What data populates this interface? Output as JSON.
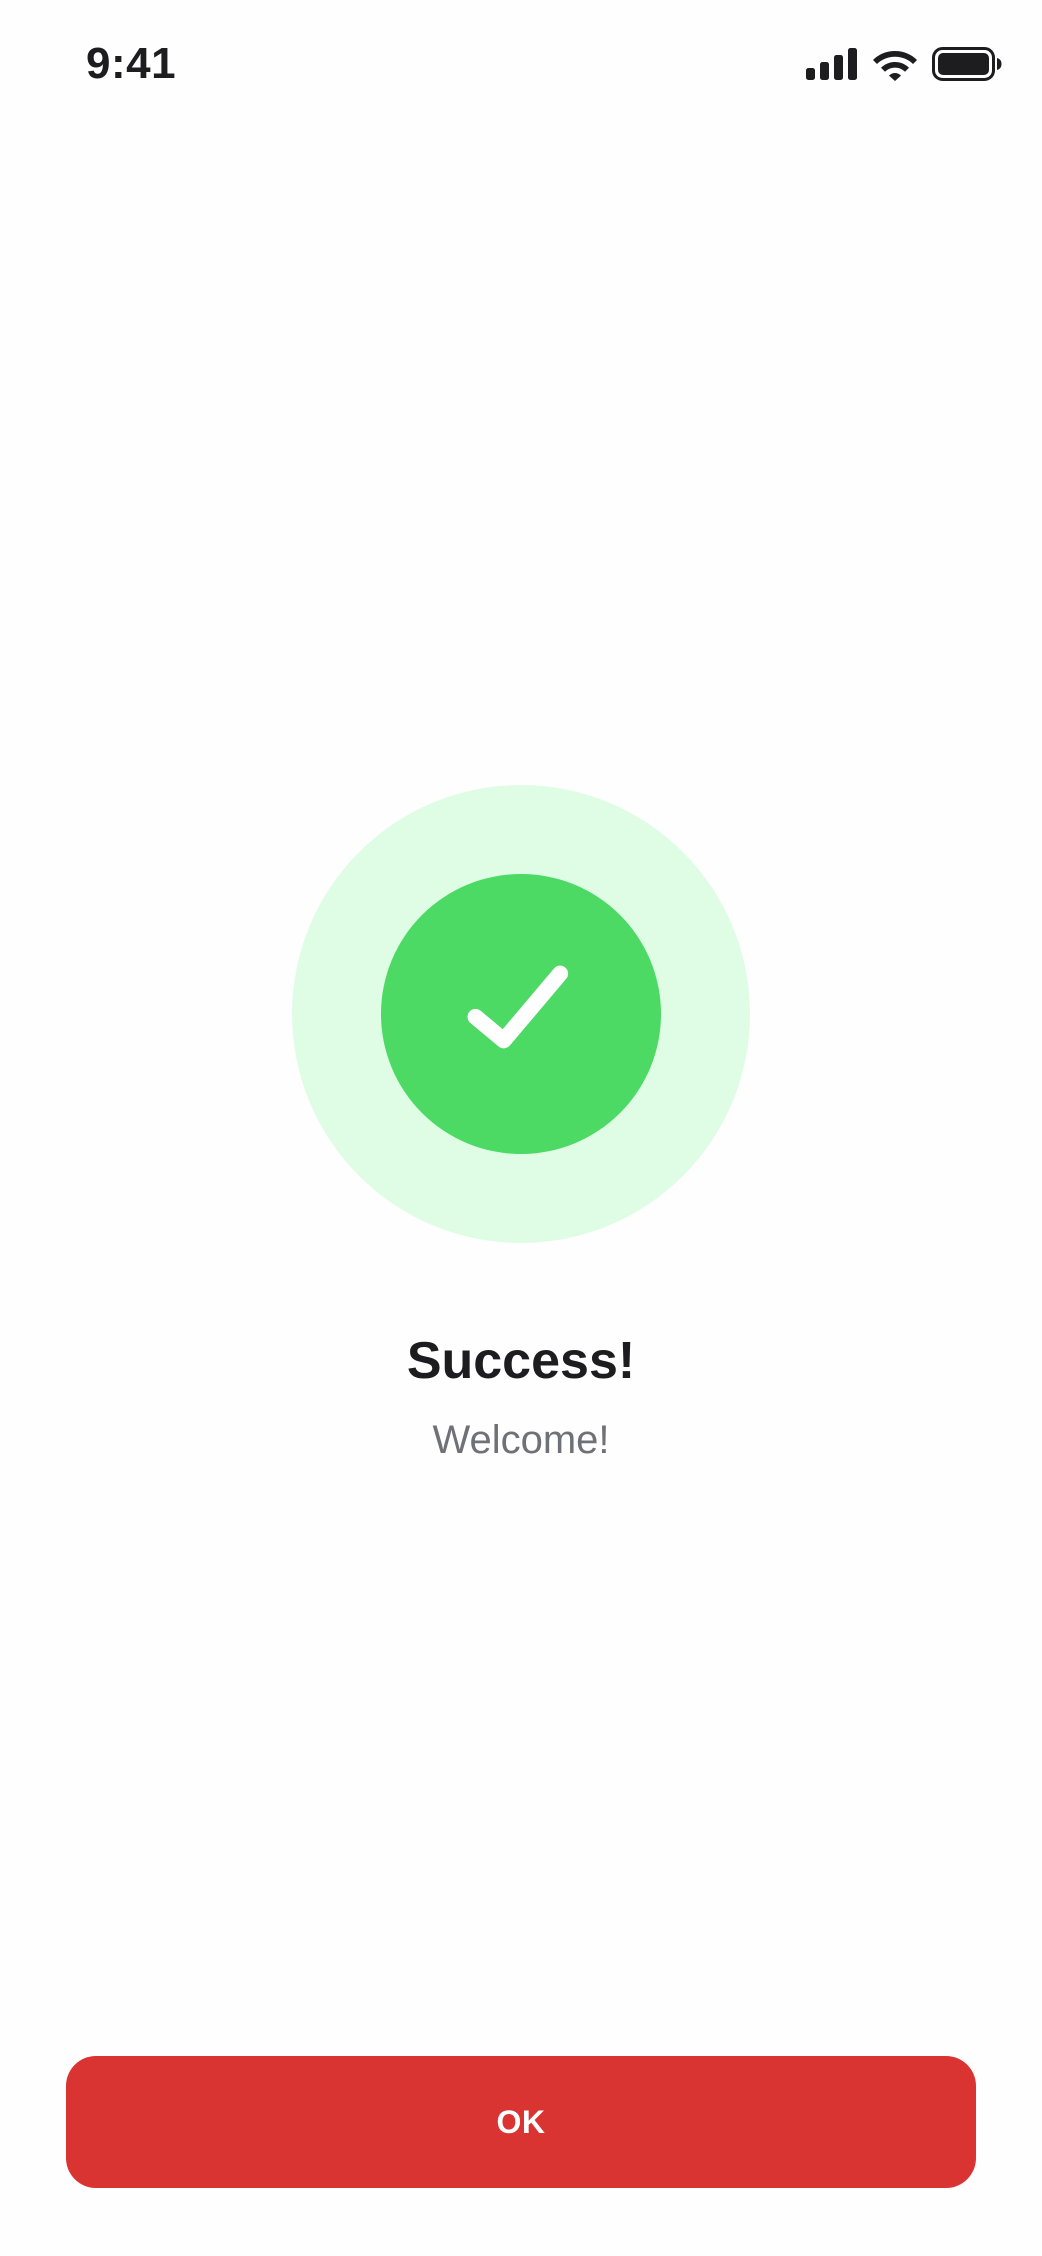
{
  "status_bar": {
    "time": "9:41",
    "icons": [
      "cellular-signal-icon",
      "wifi-icon",
      "battery-icon"
    ]
  },
  "success": {
    "icon": "checkmark-icon",
    "title": "Success!",
    "subtitle": "Welcome!"
  },
  "actions": {
    "ok_label": "OK"
  },
  "colors": {
    "badge_outer": "#DFFDE4",
    "badge_inner": "#4CD964",
    "button_bg": "#D93431",
    "title_text": "#1D1D1F",
    "subtitle_text": "#707078"
  }
}
